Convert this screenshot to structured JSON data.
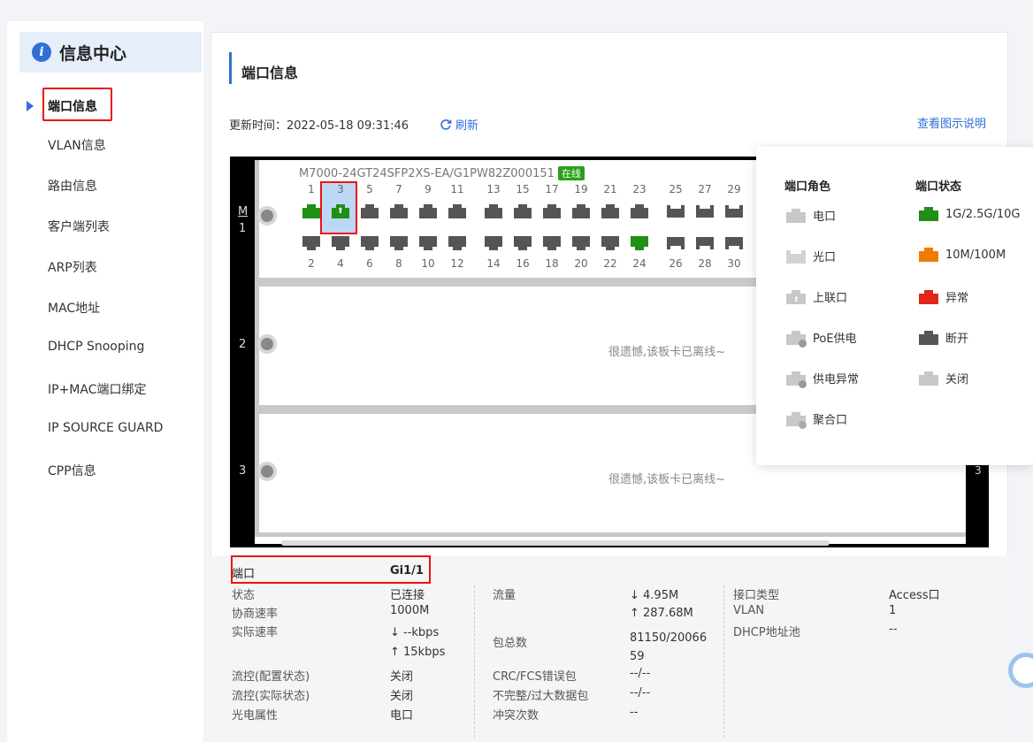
{
  "sidebar": {
    "title": "信息中心",
    "items": [
      {
        "label": "端口信息",
        "active": true
      },
      {
        "label": "VLAN信息"
      },
      {
        "label": "路由信息"
      },
      {
        "label": "客户端列表"
      },
      {
        "label": "ARP列表"
      },
      {
        "label": "MAC地址"
      },
      {
        "label": "DHCP Snooping"
      },
      {
        "label": "IP+MAC端口绑定"
      },
      {
        "label": "IP SOURCE GUARD"
      },
      {
        "label": "CPP信息"
      }
    ]
  },
  "main": {
    "section_title": "端口信息",
    "update_time": "更新时间：2022-05-18 09:31:46",
    "refresh_label": "刷新",
    "legend_link": "查看图示说明"
  },
  "chassis": {
    "slots": [
      "M\n1",
      "2",
      "3"
    ],
    "right_slot": "3",
    "device_name": "M7000-24GT24SFP2XS-EA/G1PW82Z000151",
    "online_badge": "在线",
    "top_ports": [
      "1",
      "3",
      "5",
      "7",
      "9",
      "11",
      "13",
      "15",
      "17",
      "19",
      "21",
      "23",
      "25",
      "27",
      "29"
    ],
    "bottom_ports": [
      "2",
      "4",
      "6",
      "8",
      "10",
      "12",
      "14",
      "16",
      "18",
      "20",
      "22",
      "24",
      "26",
      "28",
      "30"
    ],
    "offline_msg": "很遗憾,该板卡已离线~"
  },
  "legend": {
    "role_title": "端口角色",
    "status_title": "端口状态",
    "roles": [
      "电口",
      "光口",
      "上联口",
      "PoE供电",
      "供电异常",
      "聚合口"
    ],
    "statuses": [
      {
        "label": "1G/2.5G/10G",
        "color": "#1f8f15"
      },
      {
        "label": "10M/100M",
        "color": "#f07a00"
      },
      {
        "label": "异常",
        "color": "#e0261a"
      },
      {
        "label": "断开",
        "color": "#555555"
      },
      {
        "label": "关闭",
        "color": "#c8c8c8"
      }
    ]
  },
  "detail": {
    "port_label": "端口",
    "port_value": "Gi1/1",
    "col1": [
      {
        "k": "状态",
        "v": "已连接"
      },
      {
        "k": "协商速率",
        "v": "1000M"
      },
      {
        "k": "实际速率",
        "v": "↓ --kbps",
        "v2": "↑ 15kbps"
      },
      {
        "k": "流控(配置状态)",
        "v": "关闭"
      },
      {
        "k": "流控(实际状态)",
        "v": "关闭"
      },
      {
        "k": "光电属性",
        "v": "电口"
      }
    ],
    "col2": [
      {
        "k": "流量",
        "v": "↓ 4.95M",
        "v2": "↑ 287.68M"
      },
      {
        "k": "包总数",
        "v": "81150/20066",
        "v2": "59"
      },
      {
        "k": "CRC/FCS错误包",
        "v": "--/--"
      },
      {
        "k": "不完整/过大数据包",
        "v": "--/--"
      },
      {
        "k": "冲突次数",
        "v": "--"
      }
    ],
    "col3": [
      {
        "k": "接口类型",
        "v": "Access口"
      },
      {
        "k": "VLAN",
        "v": "1"
      },
      {
        "k": "DHCP地址池",
        "v": "--"
      }
    ]
  }
}
